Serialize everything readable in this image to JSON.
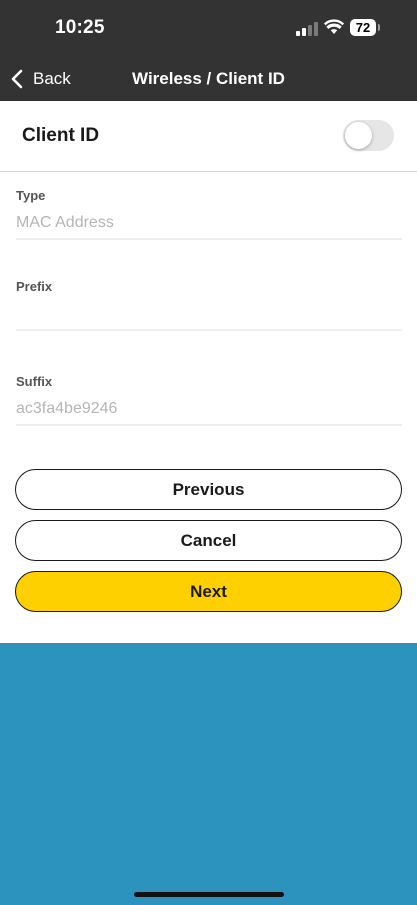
{
  "status_bar": {
    "time": "10:25",
    "battery_level": "72",
    "icons": [
      "cellular-signal-icon",
      "wifi-icon",
      "battery-icon"
    ]
  },
  "nav": {
    "back_label": "Back",
    "title": "Wireless / Client ID",
    "back_icon": "chevron-left-icon"
  },
  "client_id": {
    "label": "Client ID",
    "enabled": false
  },
  "fields": {
    "type": {
      "label": "Type",
      "value": "",
      "placeholder": "MAC Address"
    },
    "prefix": {
      "label": "Prefix",
      "value": "",
      "placeholder": ""
    },
    "suffix": {
      "label": "Suffix",
      "value": "",
      "placeholder": "ac3fa4be9246"
    }
  },
  "buttons": {
    "previous": "Previous",
    "cancel": "Cancel",
    "next": "Next"
  },
  "colors": {
    "header_bg": "#333333",
    "accent_yellow": "#ffd000",
    "footer_blue": "#2b93bd"
  }
}
